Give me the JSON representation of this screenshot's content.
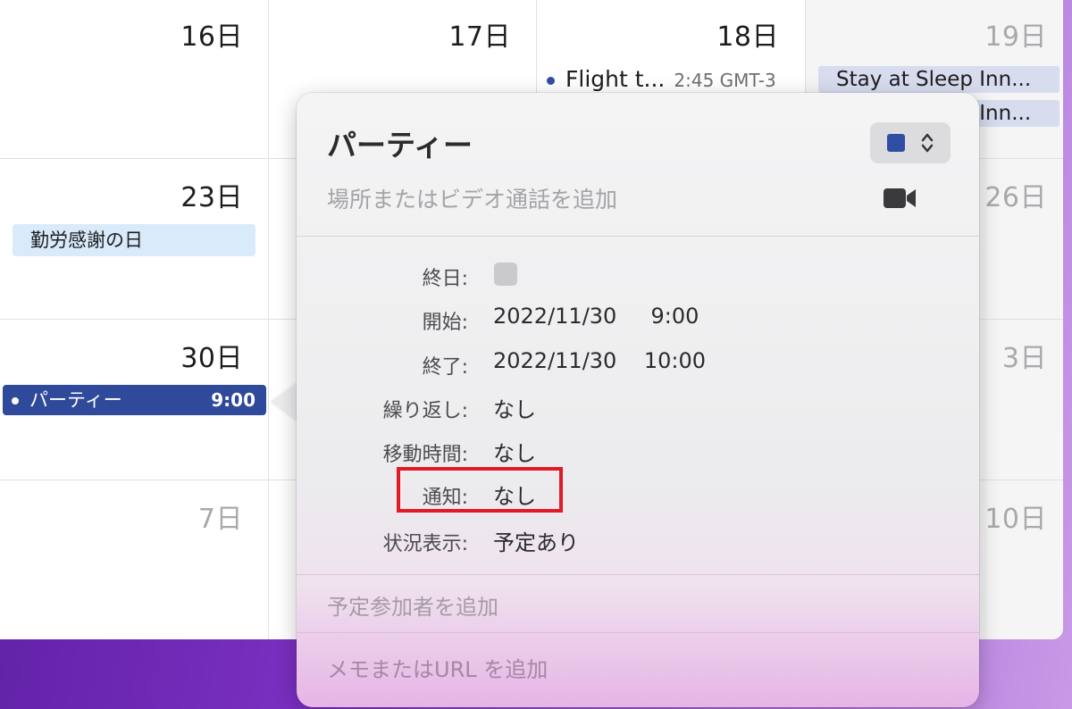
{
  "calendar": {
    "days": {
      "d16": "16日",
      "d17": "17日",
      "d18": "18日",
      "d19": "19日",
      "d23": "23日",
      "d26": "26日",
      "d30": "30日",
      "d3": "3日",
      "d7": "7日",
      "d10": "10日"
    },
    "events": {
      "flight_title": "Flight t...",
      "flight_time": "2:45 GMT-3",
      "stay_1": "Stay at Sleep Inn...",
      "stay_2": "Stay at Sleep Inn...",
      "holiday": "勤労感謝の日",
      "party_title": "パーティー",
      "party_time": "9:00"
    }
  },
  "popover": {
    "title": "パーティー",
    "location_placeholder": "場所またはビデオ通話を追加",
    "fields": {
      "allday_label": "終日:",
      "start_label": "開始:",
      "start_value": "2022/11/30     9:00",
      "end_label": "終了:",
      "end_value": "2022/11/30    10:00",
      "repeat_label": "繰り返し:",
      "repeat_value": "なし",
      "travel_label": "移動時間:",
      "travel_value": "なし",
      "alert_label": "通知:",
      "alert_value": "なし",
      "status_label": "状況表示:",
      "status_value": "予定あり"
    },
    "attendees_placeholder": "予定参加者を追加",
    "notes_placeholder": "メモまたはURL を追加"
  },
  "colors": {
    "event_blue": "#2f4ea3",
    "highlight_red": "#e01b25",
    "holiday_bg": "#d9ebfb",
    "stay_bg": "#d7dcef"
  }
}
